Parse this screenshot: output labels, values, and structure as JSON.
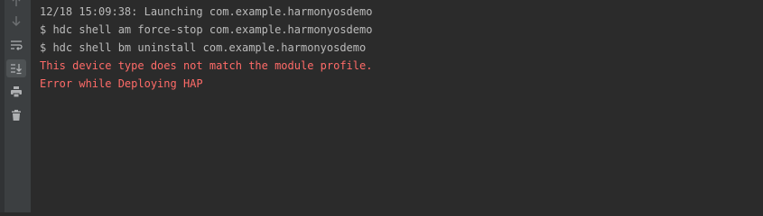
{
  "toolbar": {
    "buttons": [
      {
        "icon": "arrow-up-icon",
        "active": false
      },
      {
        "icon": "arrow-down-icon",
        "active": false
      },
      {
        "icon": "soft-wrap-icon",
        "active": false
      },
      {
        "icon": "scroll-to-end-icon",
        "active": true
      },
      {
        "icon": "print-icon",
        "active": false
      },
      {
        "icon": "trash-icon",
        "active": false
      }
    ]
  },
  "console": {
    "lines": [
      {
        "text": "12/18 15:09:38: Launching com.example.harmonyosdemo",
        "type": "info"
      },
      {
        "text": "$ hdc shell am force-stop com.example.harmonyosdemo",
        "type": "info"
      },
      {
        "text": "$ hdc shell bm uninstall com.example.harmonyosdemo",
        "type": "info"
      },
      {
        "text": "This device type does not match the module profile.",
        "type": "error"
      },
      {
        "text": "Error while Deploying HAP",
        "type": "error"
      }
    ]
  },
  "colors": {
    "background": "#2b2b2b",
    "toolbar": "#3c3f41",
    "text": "#bbbbbb",
    "error": "#ff6b68"
  }
}
